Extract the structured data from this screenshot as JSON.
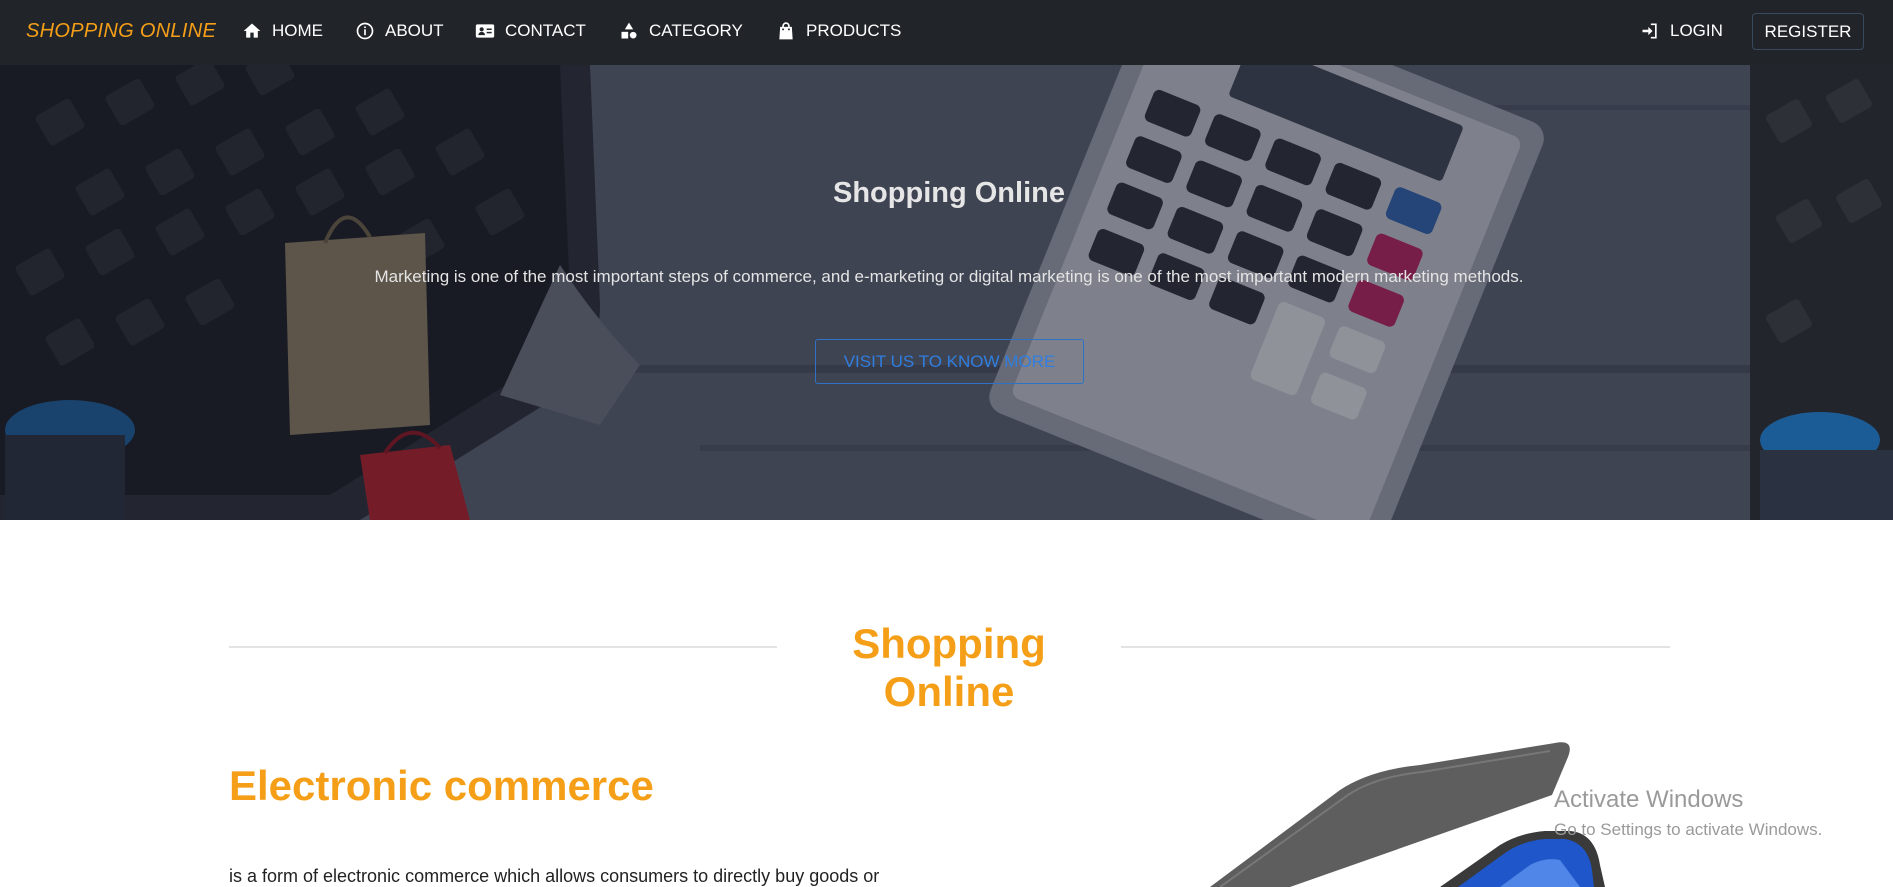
{
  "nav": {
    "brand": "SHOPPING ONLINE",
    "items": [
      {
        "label": "HOME",
        "icon": "home-icon"
      },
      {
        "label": "ABOUT",
        "icon": "info-icon"
      },
      {
        "label": "CONTACT",
        "icon": "contact-card-icon"
      },
      {
        "label": "CATEGORY",
        "icon": "category-shapes-icon"
      },
      {
        "label": "PRODUCTS",
        "icon": "shopping-bag-icon"
      }
    ],
    "login": {
      "label": "LOGIN",
      "icon": "login-icon"
    },
    "register": "REGISTER"
  },
  "hero": {
    "title": "Shopping Online",
    "text": "Marketing is one of the most important steps of commerce, and e-marketing or digital marketing is one of the most important modern marketing methods.",
    "button": "VISIT US TO KNOW MORE"
  },
  "section": {
    "title": "Shopping Online",
    "subtitle": "Electronic commerce",
    "text": "is a form of electronic commerce which allows consumers to directly buy goods or"
  },
  "watermark": {
    "title": "Activate Windows",
    "subtitle": "Go to Settings to activate Windows."
  },
  "colors": {
    "accent": "#f59f18",
    "navbar": "#212529",
    "button_blue": "#2f7ee0"
  }
}
